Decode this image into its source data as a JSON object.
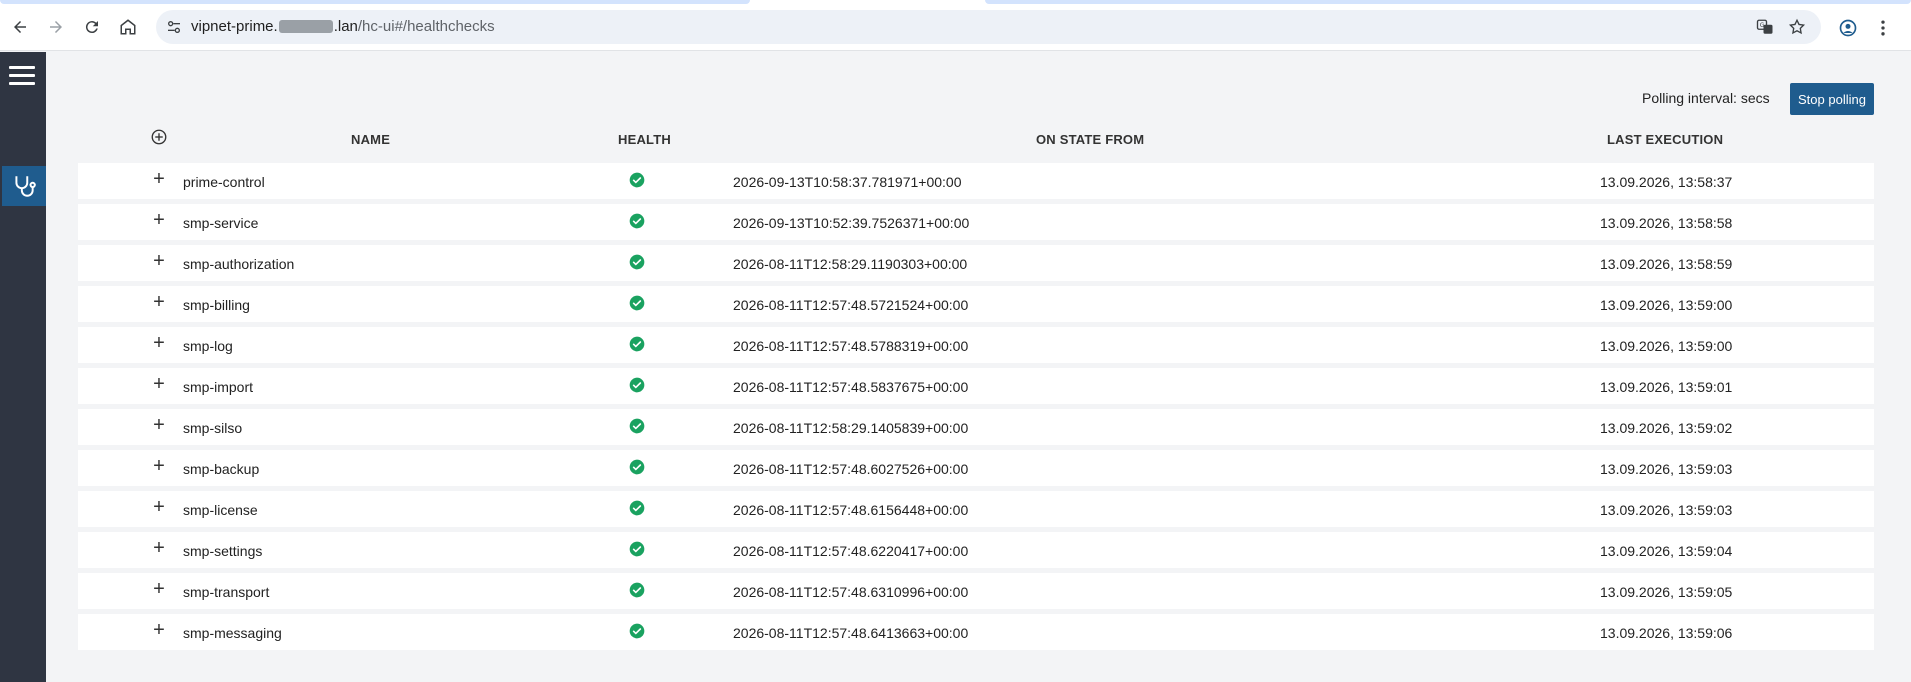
{
  "browser": {
    "url_host_start": "vipnet-prime.",
    "url_host_end": ".lan",
    "url_path": "/hc-ui#/healthchecks"
  },
  "toolbar": {
    "polling_label": "Polling interval: secs",
    "stop_label": "Stop polling"
  },
  "table": {
    "columns": [
      "NAME",
      "HEALTH",
      "ON STATE FROM",
      "LAST EXECUTION"
    ],
    "rows": [
      {
        "name": "prime-control",
        "health": "healthy",
        "on_state_from": "2026-09-13T10:58:37.781971+00:00",
        "last_execution": "13.09.2026, 13:58:37"
      },
      {
        "name": "smp-service",
        "health": "healthy",
        "on_state_from": "2026-09-13T10:52:39.7526371+00:00",
        "last_execution": "13.09.2026, 13:58:58"
      },
      {
        "name": "smp-authorization",
        "health": "healthy",
        "on_state_from": "2026-08-11T12:58:29.1190303+00:00",
        "last_execution": "13.09.2026, 13:58:59"
      },
      {
        "name": "smp-billing",
        "health": "healthy",
        "on_state_from": "2026-08-11T12:57:48.5721524+00:00",
        "last_execution": "13.09.2026, 13:59:00"
      },
      {
        "name": "smp-log",
        "health": "healthy",
        "on_state_from": "2026-08-11T12:57:48.5788319+00:00",
        "last_execution": "13.09.2026, 13:59:00"
      },
      {
        "name": "smp-import",
        "health": "healthy",
        "on_state_from": "2026-08-11T12:57:48.5837675+00:00",
        "last_execution": "13.09.2026, 13:59:01"
      },
      {
        "name": "smp-silso",
        "health": "healthy",
        "on_state_from": "2026-08-11T12:58:29.1405839+00:00",
        "last_execution": "13.09.2026, 13:59:02"
      },
      {
        "name": "smp-backup",
        "health": "healthy",
        "on_state_from": "2026-08-11T12:57:48.6027526+00:00",
        "last_execution": "13.09.2026, 13:59:03"
      },
      {
        "name": "smp-license",
        "health": "healthy",
        "on_state_from": "2026-08-11T12:57:48.6156448+00:00",
        "last_execution": "13.09.2026, 13:59:03"
      },
      {
        "name": "smp-settings",
        "health": "healthy",
        "on_state_from": "2026-08-11T12:57:48.6220417+00:00",
        "last_execution": "13.09.2026, 13:59:04"
      },
      {
        "name": "smp-transport",
        "health": "healthy",
        "on_state_from": "2026-08-11T12:57:48.6310996+00:00",
        "last_execution": "13.09.2026, 13:59:05"
      },
      {
        "name": "smp-messaging",
        "health": "healthy",
        "on_state_from": "2026-08-11T12:57:48.6413663+00:00",
        "last_execution": "13.09.2026, 13:59:06"
      }
    ],
    "expand_glyph": "+"
  },
  "colors": {
    "sidebar_bg": "#2f3542",
    "accent": "#1f5c8e",
    "healthy": "#1aa260"
  }
}
